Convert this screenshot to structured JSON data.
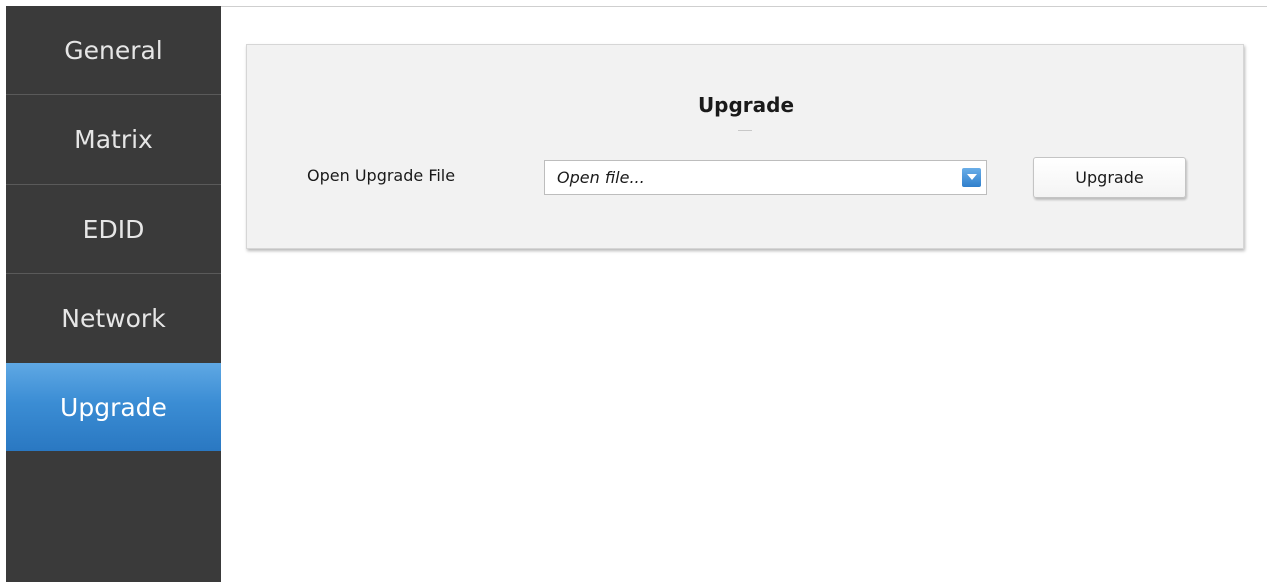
{
  "sidebar": {
    "items": [
      {
        "label": "General"
      },
      {
        "label": "Matrix"
      },
      {
        "label": "EDID"
      },
      {
        "label": "Network"
      },
      {
        "label": "Upgrade",
        "active": true
      }
    ]
  },
  "panel": {
    "title": "Upgrade",
    "open_file_label": "Open Upgrade File",
    "file_select_value": "Open file...",
    "upgrade_button_label": "Upgrade"
  },
  "colors": {
    "sidebar_bg": "#3a3a3a",
    "active_item": "#3b8dd4",
    "panel_bg": "#f2f2f2"
  },
  "icons": {
    "dropdown": "chevron-down-icon"
  }
}
